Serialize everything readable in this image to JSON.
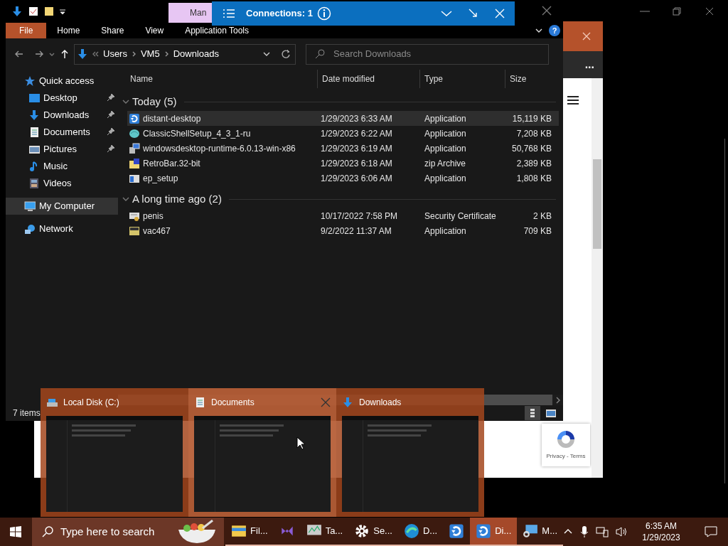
{
  "browser": {
    "more_button": "...",
    "recaptcha": {
      "links": "Privacy - Terms"
    }
  },
  "explorer": {
    "title_tab": "Man",
    "ribbon": {
      "tabs": [
        {
          "label": "File",
          "kind": "file"
        },
        {
          "label": "Home",
          "kind": "tab"
        },
        {
          "label": "Share",
          "kind": "tab"
        },
        {
          "label": "View",
          "kind": "tab"
        },
        {
          "label": "Application Tools",
          "kind": "tab"
        }
      ],
      "help_button": "?"
    },
    "address": {
      "path": [
        "Users",
        "VM5",
        "Downloads"
      ]
    },
    "search": {
      "placeholder": "Search Downloads"
    },
    "navigation": [
      {
        "label": "Quick access",
        "kind": "star",
        "selected": false,
        "children": [
          {
            "label": "Desktop",
            "kind": "desktop",
            "pinned": true,
            "selected": false
          },
          {
            "label": "Downloads",
            "kind": "download",
            "pinned": true,
            "selected": false
          },
          {
            "label": "Documents",
            "kind": "documents",
            "pinned": true,
            "selected": false
          },
          {
            "label": "Pictures",
            "kind": "pictures",
            "pinned": true,
            "selected": false
          },
          {
            "label": "Music",
            "kind": "music",
            "pinned": false,
            "selected": false
          },
          {
            "label": "Videos",
            "kind": "videos",
            "pinned": false,
            "selected": false
          }
        ]
      },
      {
        "label": "My Computer",
        "kind": "computer",
        "selected": true
      },
      {
        "label": "Network",
        "kind": "network",
        "selected": false
      }
    ],
    "columns": [
      "Name",
      "Date modified",
      "Type",
      "Size"
    ],
    "groups": [
      {
        "label": "Today (5)",
        "expanded": true,
        "rows": [
          {
            "name": "distant-desktop",
            "date": "1/29/2023 6:33 AM",
            "type": "Application",
            "size": "15,119 KB",
            "kind": "remote",
            "selected": true
          },
          {
            "name": "ClassicShellSetup_4_3_1-ru",
            "date": "1/29/2023 6:22 AM",
            "type": "Application",
            "size": "7,208 KB",
            "kind": "shell",
            "selected": false
          },
          {
            "name": "windowsdesktop-runtime-6.0.13-win-x86",
            "date": "1/29/2023 6:19 AM",
            "type": "Application",
            "size": "50,768 KB",
            "kind": "installer",
            "selected": false
          },
          {
            "name": "RetroBar.32-bit",
            "date": "1/29/2023 6:18 AM",
            "type": "zip Archive",
            "size": "2,389 KB",
            "kind": "zip",
            "selected": false
          },
          {
            "name": "ep_setup",
            "date": "1/29/2023 6:06 AM",
            "type": "Application",
            "size": "1,808 KB",
            "kind": "setup",
            "selected": false
          }
        ]
      },
      {
        "label": "A long time ago (2)",
        "expanded": true,
        "rows": [
          {
            "name": "penis",
            "date": "10/17/2022 7:58 PM",
            "type": "Security Certificate",
            "size": "2 KB",
            "kind": "certificate",
            "selected": false
          },
          {
            "name": "vac467",
            "date": "9/2/2022 11:37 AM",
            "type": "Application",
            "size": "709 KB",
            "kind": "program",
            "selected": false
          }
        ]
      }
    ],
    "status_bar": {
      "item_count": "7 items"
    }
  },
  "connections_bar": {
    "title": "Connections: 1"
  },
  "task_view": [
    {
      "title": "Local Disk (C:)",
      "kind": "drive",
      "selected": false
    },
    {
      "title": "Documents",
      "kind": "documents",
      "selected": true
    },
    {
      "title": "Downloads",
      "kind": "download",
      "selected": false
    }
  ],
  "taskbar": {
    "search": {
      "placeholder": "Type here to search"
    },
    "apps": [
      {
        "label": "Fil...",
        "kind": "folder",
        "active": false
      },
      {
        "kind": "studio",
        "active": false
      },
      {
        "label": "Ta...",
        "kind": "monitor",
        "active": false
      },
      {
        "label": "Se...",
        "kind": "gear",
        "active": false
      },
      {
        "label": "D...",
        "kind": "browser",
        "active": false
      },
      {
        "kind": "remote",
        "active": false
      },
      {
        "label": "Di...",
        "kind": "remote",
        "active": true
      },
      {
        "label": "M...",
        "kind": "magnifier",
        "active": false
      }
    ],
    "clock": {
      "time": "6:35 AM",
      "date": "1/29/2023"
    }
  }
}
